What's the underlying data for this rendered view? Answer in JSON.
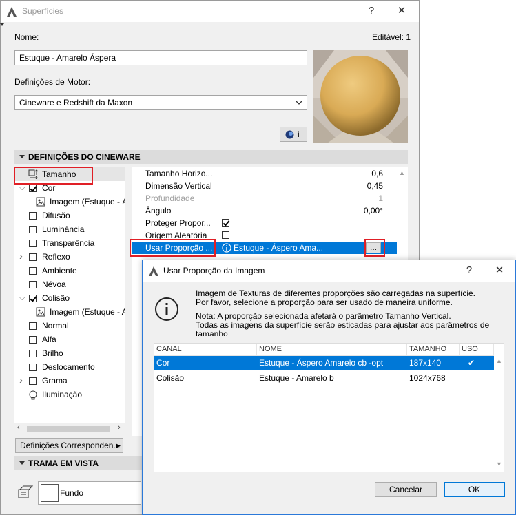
{
  "main_window": {
    "title": "Superfícies",
    "help": "?",
    "close": "✕",
    "name_label": "Nome:",
    "editable": "Editável: 1",
    "name_value": "Estuque - Amarelo Áspera",
    "engine_label": "Definições de Motor:",
    "engine_value": "Cineware e Redshift da Maxon",
    "info_button": "i",
    "cineware_section": "DEFINIÇÕES DO CINEWARE",
    "trama_section": "TRAMA EM VISTA",
    "matching_button": "Definições Corresponden...",
    "fundo_label": "Fundo"
  },
  "channels": [
    {
      "label": "Tamanho",
      "icon": "size-icon",
      "checkbox": "none",
      "expander": ""
    },
    {
      "label": "Cor",
      "checkbox": "checked",
      "expander": "down"
    },
    {
      "label": "Imagem (Estuque - Ás",
      "icon": "image-icon",
      "checkbox": "none",
      "expander": ""
    },
    {
      "label": "Difusão",
      "checkbox": "unchecked",
      "expander": ""
    },
    {
      "label": "Luminância",
      "checkbox": "unchecked",
      "expander": ""
    },
    {
      "label": "Transparência",
      "checkbox": "unchecked",
      "expander": ""
    },
    {
      "label": "Reflexo",
      "checkbox": "unchecked",
      "expander": "right"
    },
    {
      "label": "Ambiente",
      "checkbox": "unchecked",
      "expander": ""
    },
    {
      "label": "Névoa",
      "checkbox": "unchecked",
      "expander": ""
    },
    {
      "label": "Colisão",
      "checkbox": "checked",
      "expander": "down"
    },
    {
      "label": "Imagem (Estuque - Am",
      "icon": "image-icon",
      "checkbox": "none",
      "expander": ""
    },
    {
      "label": "Normal",
      "checkbox": "unchecked",
      "expander": ""
    },
    {
      "label": "Alfa",
      "checkbox": "unchecked",
      "expander": ""
    },
    {
      "label": "Brilho",
      "checkbox": "unchecked",
      "expander": ""
    },
    {
      "label": "Deslocamento",
      "checkbox": "unchecked",
      "expander": ""
    },
    {
      "label": "Grama",
      "checkbox": "unchecked",
      "expander": "right"
    },
    {
      "label": "Iluminação",
      "icon": "light-icon",
      "checkbox": "none",
      "expander": ""
    }
  ],
  "properties": [
    {
      "label": "Tamanho Horizo...",
      "value": "0,6",
      "state": "normal"
    },
    {
      "label": "Dimensão Vertical",
      "value": "0,45",
      "state": "normal"
    },
    {
      "label": "Profundidade",
      "value": "1",
      "state": "disabled"
    },
    {
      "label": "Ângulo",
      "value": "0,00°",
      "state": "normal"
    },
    {
      "label": "Proteger Propor...",
      "value": "",
      "state": "checkbox-checked"
    },
    {
      "label": "Origem Aleatória",
      "value": "",
      "state": "checkbox-unchecked"
    }
  ],
  "selected_property": {
    "label": "Usar Proporção ...",
    "value": "Estuque - Áspero Ama...",
    "button": "..."
  },
  "dialog": {
    "title": "Usar Proporção da Imagem",
    "help": "?",
    "close": "✕",
    "line1": "Imagem de Texturas de diferentes proporções são carregadas na superfície.",
    "line2": "Por favor, selecione a proporção para ser usado de maneira uniforme.",
    "note1": "Nota: A proporção selecionada afetará o parâmetro Tamanho Vertical.",
    "note2": "Todas as imagens da superfície serão esticadas para ajustar aos parâmetros de",
    "note3": "tamanho",
    "columns": [
      "CANAL",
      "NOME",
      "TAMANHO",
      "USO"
    ],
    "rows": [
      {
        "canal": "Cor",
        "nome": "Estuque - Áspero Amarelo cb -opt",
        "tamanho": "187x140",
        "uso": "✔",
        "selected": true
      },
      {
        "canal": "Colisão",
        "nome": "Estuque - Amarelo b",
        "tamanho": "1024x768",
        "uso": "",
        "selected": false
      }
    ],
    "cancel": "Cancelar",
    "ok": "OK"
  },
  "colors": {
    "selection": "#0078d7",
    "highlight_box": "#e01f26",
    "plaster": "#d9aa55"
  }
}
